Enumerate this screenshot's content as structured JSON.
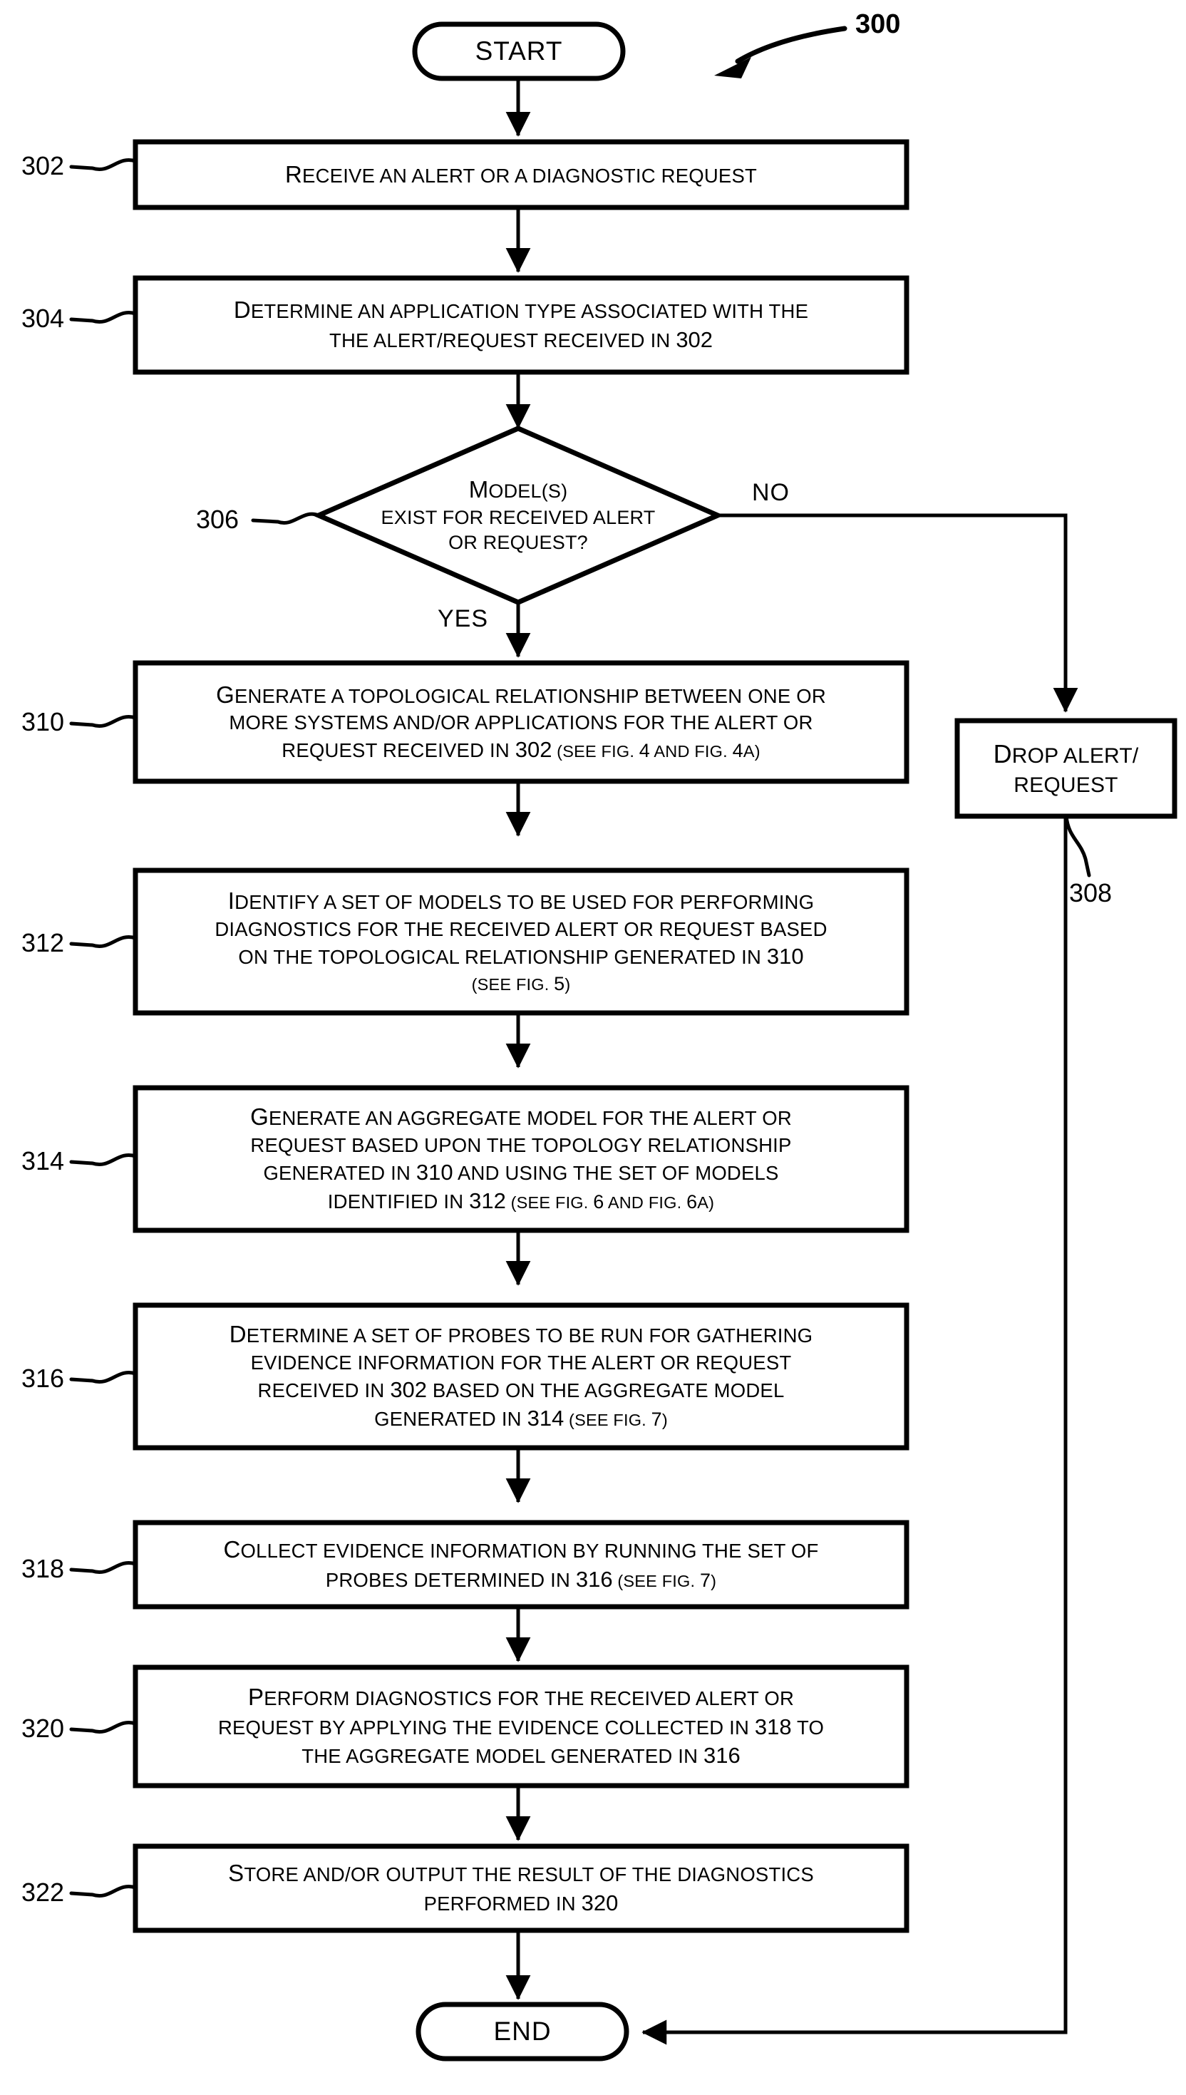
{
  "figure": {
    "reference_numeral": "300"
  },
  "terminators": {
    "start": "START",
    "end": "END"
  },
  "branches": {
    "yes": "YES",
    "no": "NO"
  },
  "nodes": [
    {
      "id": "302",
      "ref": "302",
      "shape": "process",
      "lines": [
        [
          {
            "t": "R",
            "s": "cap"
          },
          {
            "t": "eceive an alert or a diagnostic request",
            "s": "n"
          }
        ]
      ]
    },
    {
      "id": "304",
      "ref": "304",
      "shape": "process",
      "lines": [
        [
          {
            "t": "D",
            "s": "cap"
          },
          {
            "t": "etermine an application type associated with the",
            "s": "n"
          }
        ],
        [
          {
            "t": "the alert/request received in ",
            "s": "n"
          },
          {
            "t": "302",
            "s": "num"
          }
        ]
      ]
    },
    {
      "id": "306",
      "ref": "306",
      "shape": "decision",
      "lines": [
        [
          {
            "t": "M",
            "s": "cap"
          },
          {
            "t": "odel(s)",
            "s": "n"
          }
        ],
        [
          {
            "t": "exist for received alert",
            "s": "n"
          }
        ],
        [
          {
            "t": "or request?",
            "s": "n"
          }
        ]
      ]
    },
    {
      "id": "308",
      "ref": "308",
      "shape": "process",
      "lines": [
        [
          {
            "t": "D",
            "s": "cap"
          },
          {
            "t": "rop alert/",
            "s": "n"
          }
        ],
        [
          {
            "t": "request",
            "s": "n"
          }
        ]
      ]
    },
    {
      "id": "310",
      "ref": "310",
      "shape": "process",
      "lines": [
        [
          {
            "t": "G",
            "s": "cap"
          },
          {
            "t": "enerate a topological relationship between one or",
            "s": "n"
          }
        ],
        [
          {
            "t": "more systems and/or applications for the alert or",
            "s": "n"
          }
        ],
        [
          {
            "t": "request received in ",
            "s": "n"
          },
          {
            "t": "302",
            "s": "num"
          },
          {
            "t": " (see fig. ",
            "s": "small"
          },
          {
            "t": "4",
            "s": "smallnum"
          },
          {
            "t": " and fig. ",
            "s": "small"
          },
          {
            "t": "4",
            "s": "smallnum"
          },
          {
            "t": "a)",
            "s": "small"
          }
        ]
      ]
    },
    {
      "id": "312",
      "ref": "312",
      "shape": "process",
      "lines": [
        [
          {
            "t": "I",
            "s": "cap"
          },
          {
            "t": "dentify a set of models to be used for performing",
            "s": "n"
          }
        ],
        [
          {
            "t": "diagnostics for the received alert or request based",
            "s": "n"
          }
        ],
        [
          {
            "t": "on the topological relationship generated in ",
            "s": "n"
          },
          {
            "t": "310",
            "s": "num"
          }
        ],
        [
          {
            "t": "(see fig. ",
            "s": "small"
          },
          {
            "t": "5",
            "s": "smallnum"
          },
          {
            "t": ")",
            "s": "small"
          }
        ]
      ]
    },
    {
      "id": "314",
      "ref": "314",
      "shape": "process",
      "lines": [
        [
          {
            "t": "G",
            "s": "cap"
          },
          {
            "t": "enerate an aggregate model for the alert or",
            "s": "n"
          }
        ],
        [
          {
            "t": "request based upon the topology relationship",
            "s": "n"
          }
        ],
        [
          {
            "t": "generated in ",
            "s": "n"
          },
          {
            "t": "310",
            "s": "num"
          },
          {
            "t": " and using the set of models",
            "s": "n"
          }
        ],
        [
          {
            "t": "identified in ",
            "s": "n"
          },
          {
            "t": "312",
            "s": "num"
          },
          {
            "t": "  (see fig. ",
            "s": "small"
          },
          {
            "t": "6",
            "s": "smallnum"
          },
          {
            "t": " and fig. ",
            "s": "small"
          },
          {
            "t": "6",
            "s": "smallnum"
          },
          {
            "t": "a)",
            "s": "small"
          }
        ]
      ]
    },
    {
      "id": "316",
      "ref": "316",
      "shape": "process",
      "lines": [
        [
          {
            "t": "D",
            "s": "cap"
          },
          {
            "t": "etermine a set of probes to be run for gathering",
            "s": "n"
          }
        ],
        [
          {
            "t": "evidence information for the alert or request",
            "s": "n"
          }
        ],
        [
          {
            "t": "received in ",
            "s": "n"
          },
          {
            "t": "302",
            "s": "num"
          },
          {
            "t": " based on the aggregate model",
            "s": "n"
          }
        ],
        [
          {
            "t": "generated in ",
            "s": "n"
          },
          {
            "t": "314",
            "s": "num"
          },
          {
            "t": " (see fig. ",
            "s": "small"
          },
          {
            "t": "7",
            "s": "smallnum"
          },
          {
            "t": ")",
            "s": "small"
          }
        ]
      ]
    },
    {
      "id": "318",
      "ref": "318",
      "shape": "process",
      "lines": [
        [
          {
            "t": "C",
            "s": "cap"
          },
          {
            "t": "ollect evidence information by running the set of",
            "s": "n"
          }
        ],
        [
          {
            "t": "probes determined in ",
            "s": "n"
          },
          {
            "t": "316",
            "s": "num"
          },
          {
            "t": " (see fig. ",
            "s": "small"
          },
          {
            "t": "7",
            "s": "smallnum"
          },
          {
            "t": ")",
            "s": "small"
          }
        ]
      ]
    },
    {
      "id": "320",
      "ref": "320",
      "shape": "process",
      "lines": [
        [
          {
            "t": "P",
            "s": "cap"
          },
          {
            "t": "erform diagnostics for the received alert or",
            "s": "n"
          }
        ],
        [
          {
            "t": "request by applying the evidence collected in ",
            "s": "n"
          },
          {
            "t": "318",
            "s": "num"
          },
          {
            "t": " to",
            "s": "n"
          }
        ],
        [
          {
            "t": "the aggregate model generated in ",
            "s": "n"
          },
          {
            "t": "316",
            "s": "num"
          }
        ]
      ]
    },
    {
      "id": "322",
      "ref": "322",
      "shape": "process",
      "lines": [
        [
          {
            "t": "S",
            "s": "cap"
          },
          {
            "t": "tore and/or output the result of the diagnostics",
            "s": "n"
          }
        ],
        [
          {
            "t": "performed in ",
            "s": "n"
          },
          {
            "t": "320",
            "s": "num"
          }
        ]
      ]
    }
  ],
  "colors": {
    "stroke": "#000000",
    "background": "#ffffff"
  }
}
